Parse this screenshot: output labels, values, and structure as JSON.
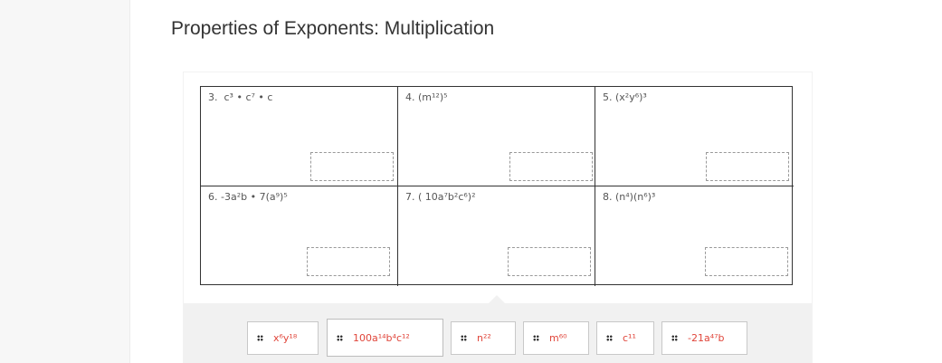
{
  "page_title": "Properties of Exponents: Multiplication",
  "problems": [
    {
      "number": "3.",
      "expression": "c³ • c⁷ • c"
    },
    {
      "number": "4.",
      "expression": "(m¹²)⁵"
    },
    {
      "number": "5.",
      "expression": "(x²y⁶)³"
    },
    {
      "number": "6.",
      "expression": "-3a²b • 7(a⁹)⁵"
    },
    {
      "number": "7.",
      "expression": "( 10a⁷b²c⁶)²"
    },
    {
      "number": "8.",
      "expression": "(n⁴)(n⁶)³"
    }
  ],
  "answer_tiles": [
    {
      "label": "x⁶y¹⁸"
    },
    {
      "label": "100a¹⁴b⁴c¹²"
    },
    {
      "label": "n²²"
    },
    {
      "label": "m⁶⁰"
    },
    {
      "label": "c¹¹"
    },
    {
      "label": "-21a⁴⁷b"
    }
  ],
  "colors": {
    "tile_text": "#e0453a",
    "tray_background": "#f1f1f1",
    "grid_line": "#333333"
  },
  "icons": {
    "drag_handle": "drag-handle-icon"
  }
}
